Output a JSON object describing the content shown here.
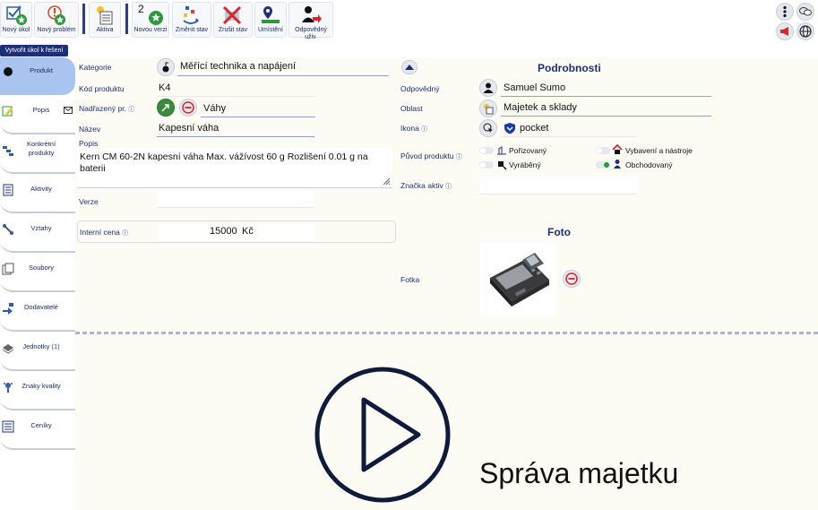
{
  "toolbar": {
    "new_task": "Nový úkol",
    "new_problem": "Nový problém",
    "asset": "Aktiva",
    "new_version_num": "2",
    "new_version": "Novou verzi",
    "change_state": "Změnit stav",
    "cancel_state": "Zrušit stav",
    "location": "Umístění",
    "responsible_user": "Odpovědný uživ."
  },
  "banner": "Vytvořit úkol k řešení",
  "sidebar": {
    "items": [
      {
        "label": "Produkt",
        "icon": "circle-icon"
      },
      {
        "label": "Popis",
        "icon": "edit-icon"
      },
      {
        "label": "Konkrétní produkty",
        "icon": "products-icon"
      },
      {
        "label": "Aktivity",
        "icon": "activity-icon"
      },
      {
        "label": "Vztahy",
        "icon": "link-icon"
      },
      {
        "label": "Soubory",
        "icon": "files-icon"
      },
      {
        "label": "Dodavatelé",
        "icon": "suppliers-icon"
      },
      {
        "label": "Jednotky",
        "count": "(1)",
        "icon": "units-icon"
      },
      {
        "label": "Znaky kvality",
        "icon": "quality-icon"
      },
      {
        "label": "Ceníky",
        "icon": "pricelist-icon"
      }
    ]
  },
  "form": {
    "category_label": "Kategorie",
    "category_value": "Měřící technika a napájení",
    "code_label": "Kód produktu",
    "code_value": "K4",
    "parent_label": "Nadřazený pr.",
    "parent_value": "Váhy",
    "name_label": "Název",
    "name_value": "Kapesní váha",
    "desc_label": "Popis",
    "desc_value": "Kern CM 60-2N kapesní váha Max. vážívost 60 g Rozlišení 0.01 g na baterii",
    "version_label": "Verze",
    "version_value": "",
    "price_label": "Interní cena",
    "price_value": "15000",
    "price_currency": "Kč"
  },
  "details": {
    "title": "Podrobnosti",
    "responsible_label": "Odpovědný",
    "responsible_value": "Samuel Sumo",
    "area_label": "Oblast",
    "area_value": "Majetek a sklady",
    "icon_label": "Ikona",
    "icon_value": "pocket",
    "origin_label": "Původ produktu",
    "origin_options": [
      "Pořizovaný",
      "Vybavení a nástroje",
      "Vyráběný",
      "Obchodovaný"
    ],
    "asset_mark_label": "Značka aktiv",
    "photo_title": "Foto",
    "photo_label": "Fotka"
  },
  "overlay": {
    "caption": "Správa majetku"
  },
  "colors": {
    "accent": "#1d2f7a",
    "active_tab": "#a9c5ef",
    "background": "#fdfcf4"
  }
}
